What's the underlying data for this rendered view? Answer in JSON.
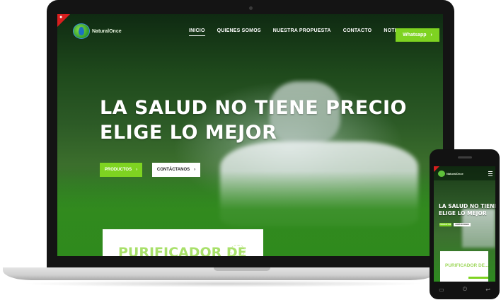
{
  "desktop": {
    "brand": {
      "logo_text": "NaturalOnce"
    },
    "nav": {
      "items": [
        "INICIO",
        "QUIENES SOMOS",
        "NUESTRA PROPUESTA",
        "CONTACTO",
        "NOTICIAS"
      ],
      "active": "INICIO"
    },
    "whatsapp_label": "Whatsapp",
    "hero": {
      "line1": "LA SALUD NO TIENE PRECIO",
      "line2": "ELIGE LO MEJOR"
    },
    "buttons": {
      "products": "PRODUCTOS",
      "contact": "CONTÁCTANOS"
    },
    "card": {
      "title": "PURIFICADOR DE"
    }
  },
  "mobile": {
    "brand": {
      "logo_text": "NaturalOnce"
    },
    "hero": {
      "line1": "LA SALUD NO TIENE PRECIO",
      "line2": "ELIGE LO MEJOR"
    },
    "buttons": {
      "products": "PRODUCTOS",
      "contact": "CONTÁCTANOS"
    },
    "card": {
      "title": "PURIFICADOR DE..."
    },
    "keys": {
      "recent": "▭",
      "home": "⏻",
      "back": "↩"
    }
  },
  "colors": {
    "accent": "#7ed321",
    "badge": "#d91e1e",
    "device": "#141414"
  }
}
